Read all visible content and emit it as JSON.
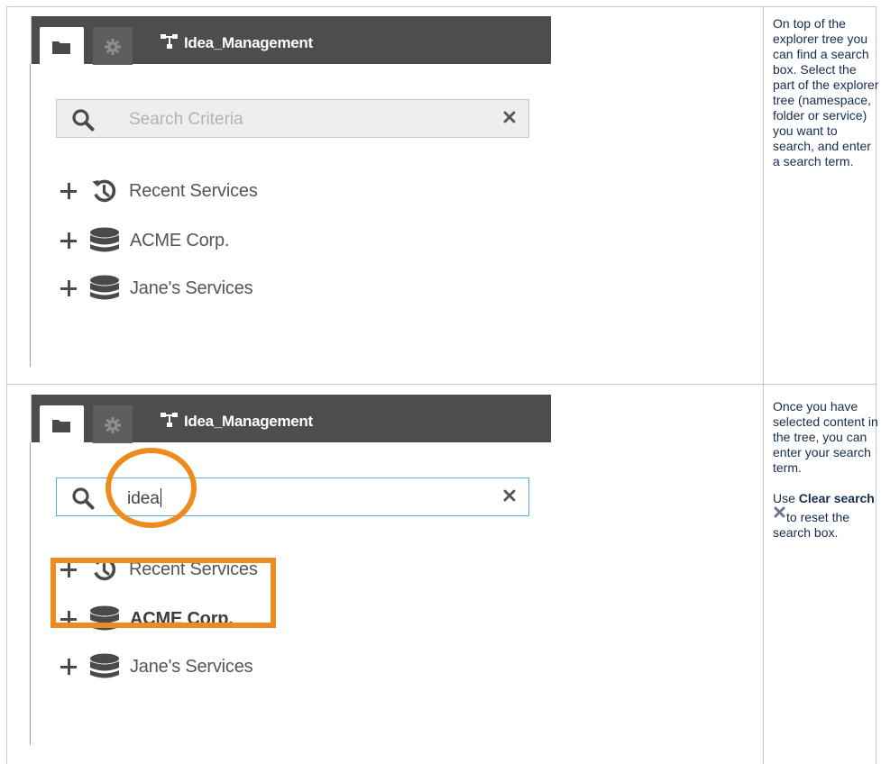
{
  "colors": {
    "tabbar": "#4d4d4d",
    "accent": "#ee8b1e",
    "focus_border": "#5aa9df",
    "text": "#172b4d"
  },
  "rows": [
    {
      "panel": {
        "tabs": [
          {
            "icon": "folder-icon",
            "active": true
          },
          {
            "icon": "gear-icon",
            "active": false
          }
        ],
        "project_icon": "project-tree-icon",
        "project_name": "Idea_Management",
        "search": {
          "placeholder": "Search Criteria",
          "value": "",
          "focused": false
        },
        "tree": [
          {
            "icon": "history-icon",
            "label": "Recent Services",
            "bold": false
          },
          {
            "icon": "database-icon",
            "label": "ACME Corp.",
            "bold": false
          },
          {
            "icon": "database-icon",
            "label": "Jane's Services",
            "bold": false
          }
        ]
      },
      "description": "On top of the explorer tree you can find a search box. Select the part of the explorer tree (namespace, folder or service) you want to search, and enter a search term."
    },
    {
      "panel": {
        "tabs": [
          {
            "icon": "folder-icon",
            "active": true
          },
          {
            "icon": "gear-icon",
            "active": false
          }
        ],
        "project_icon": "project-tree-icon",
        "project_name": "Idea_Management",
        "search": {
          "placeholder": "Search Criteria",
          "value": "idea",
          "focused": true
        },
        "tree": [
          {
            "icon": "history-icon",
            "label": "Recent Services",
            "bold": false
          },
          {
            "icon": "database-icon",
            "label": "ACME Corp.",
            "bold": true
          },
          {
            "icon": "database-icon",
            "label": "Jane's Services",
            "bold": false
          }
        ]
      },
      "description_p1": "Once you have selected content in the tree, you can enter your search term.",
      "description_p2": {
        "prefix": "Use",
        "bold": "Clear search",
        "icon": "clear-search-icon",
        "suffix": "to reset the search box."
      }
    }
  ]
}
